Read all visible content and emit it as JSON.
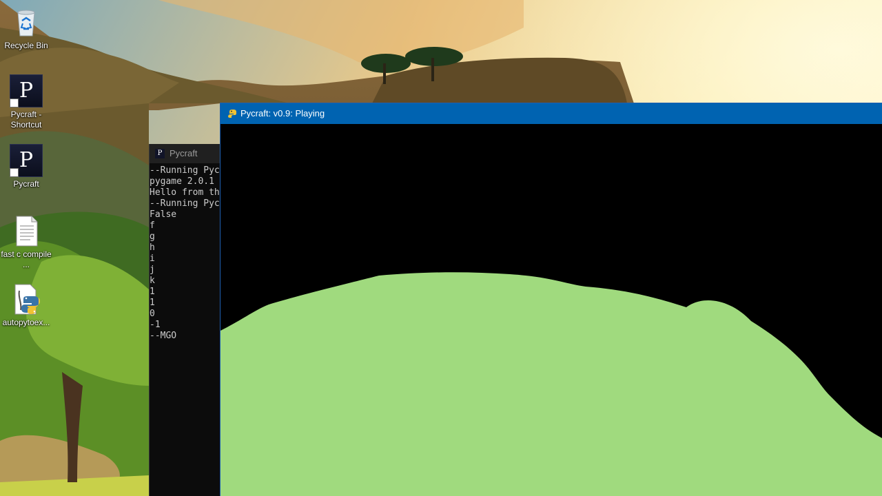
{
  "desktop": {
    "icons": [
      {
        "label": "Recycle Bin",
        "icon": "recycle-bin-icon"
      },
      {
        "label": "Pycraft - Shortcut",
        "icon": "pycraft-icon"
      },
      {
        "label": "Pycraft",
        "icon": "pycraft-icon"
      },
      {
        "label": "fast c compile ...",
        "icon": "text-file-icon"
      },
      {
        "label": "autopytoex...",
        "icon": "python-file-icon"
      }
    ],
    "pycraft_glyph": "P"
  },
  "console": {
    "title": "Pycraft",
    "lines": [
      "--Running Pyc",
      "pygame 2.0.1",
      "Hello from th",
      "--Running Pyc",
      "False",
      "f",
      "g",
      "h",
      "i",
      "j",
      "k",
      "1",
      "1",
      "0",
      "-1",
      "--MGO"
    ]
  },
  "game": {
    "title": "Pycraft: v0.9: Playing",
    "sky_color": "#000000",
    "terrain_color": "#a0da7e",
    "titlebar_color": "#0063b1"
  }
}
